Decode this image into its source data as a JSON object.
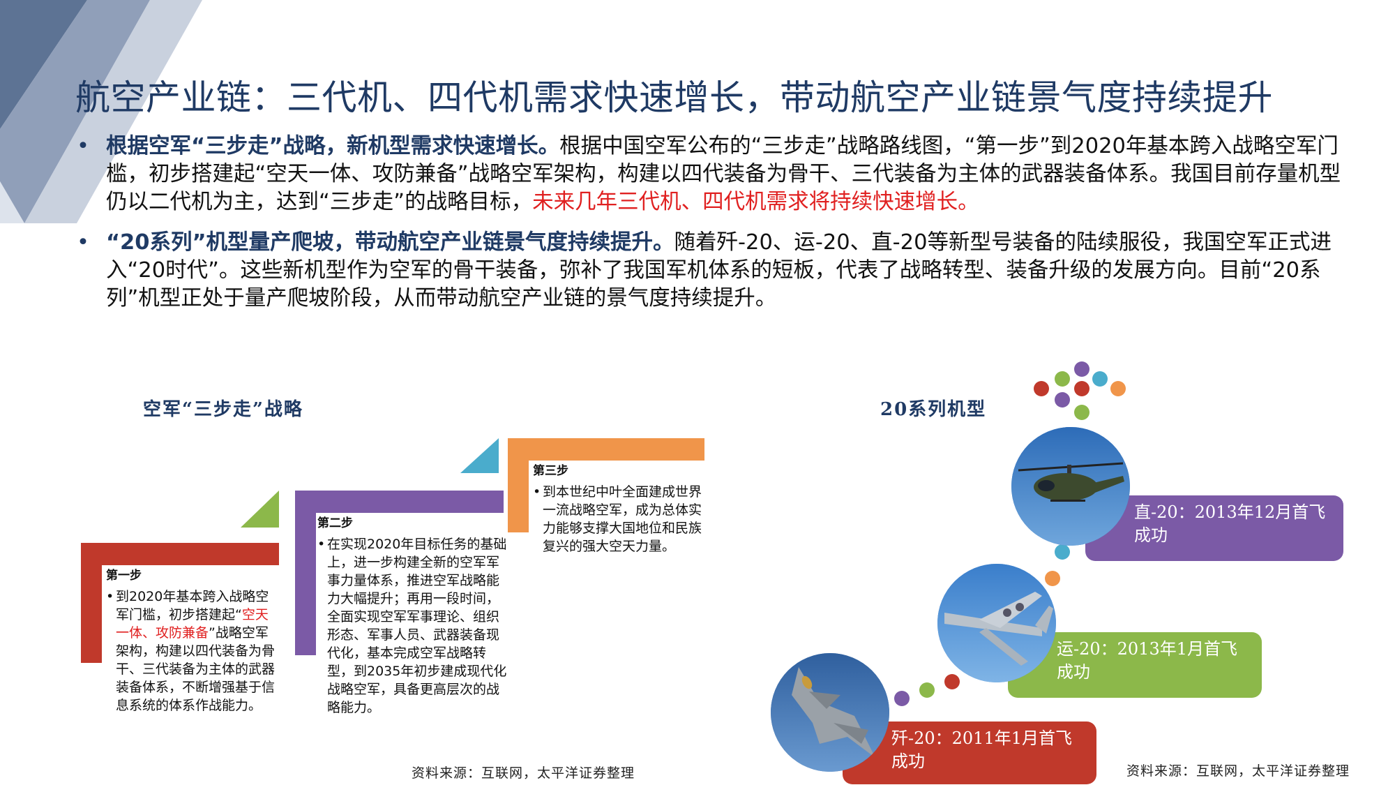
{
  "title": "航空产业链：三代机、四代机需求快速增长，带动航空产业链景气度持续提升",
  "bullets": [
    {
      "bold": "根据空军“三步走”战略，新机型需求快速增长。",
      "text": "根据中国空军公布的“三步走”战略路线图，“第一步”到2020年基本跨入战略空军门槛，初步搭建起“空天一体、攻防兼备”战略空军架构，构建以四代装备为骨干、三代装备为主体的武器装备体系。我国目前存量机型仍以二代机为主，达到“三步走”的战略目标，",
      "red": "未来几年三代机、四代机需求将持续快速增长。"
    },
    {
      "bold": "“20系列”机型量产爬坡，带动航空产业链景气度持续提升。",
      "text": "随着歼-20、运-20、直-20等新型号装备的陆续服役，我国空军正式进入“20时代”。这些新机型作为空军的骨干装备，弥补了我国军机体系的短板，代表了战略转型、装备升级的发展方向。目前“20系列”机型正处于量产爬坡阶段，从而带动航空产业链的景气度持续提升。"
    }
  ],
  "left_section": {
    "title": "空军“三步走”战略",
    "source": "资料来源：互联网，太平洋证券整理",
    "steps": [
      {
        "label": "第一步",
        "color": "#c0392b",
        "text_before": "到2020年基本跨入战略空军门槛，初步搭建起“",
        "text_red": "空天一体、攻防兼备",
        "text_after": "”战略空军架构，构建以四代装备为骨干、三代装备为主体的武器装备体系，不断增强基于信息系统的体系作战能力。"
      },
      {
        "label": "第二步",
        "color": "#7b5aa6",
        "text": "在实现2020年目标任务的基础上，进一步构建全新的空军军事力量体系，推进空军战略能力大幅提升；再用一段时间，全面实现空军军事理论、组织形态、军事人员、武器装备现代化，基本完成空军战略转型，到2035年初步建成现代化战略空军，具备更高层次的战略能力。"
      },
      {
        "label": "第三步",
        "color": "#f0954a",
        "text": "到本世纪中叶全面建成世界一流战略空军，成为总体实力能够支撑大国地位和民族复兴的强大空天力量。"
      }
    ]
  },
  "right_section": {
    "title": "20系列机型",
    "source": "资料来源：互联网，太平洋证券整理",
    "aircraft": [
      {
        "label": "直-20：2013年12月首飞成功",
        "color": "#7b5aa6",
        "icon": "helicopter-icon"
      },
      {
        "label": "运-20：2013年1月首飞成功",
        "color": "#8cb84a",
        "icon": "transport-plane-icon"
      },
      {
        "label": "歼-20：2011年1月首飞成功",
        "color": "#c0392b",
        "icon": "fighter-jet-icon"
      }
    ]
  },
  "colors": {
    "title_blue": "#1f3a64",
    "red_highlight": "#e02020",
    "green": "#8cb84a",
    "teal": "#4aaccc",
    "orange": "#f0954a",
    "purple": "#7b5aa6",
    "red": "#c0392b"
  }
}
